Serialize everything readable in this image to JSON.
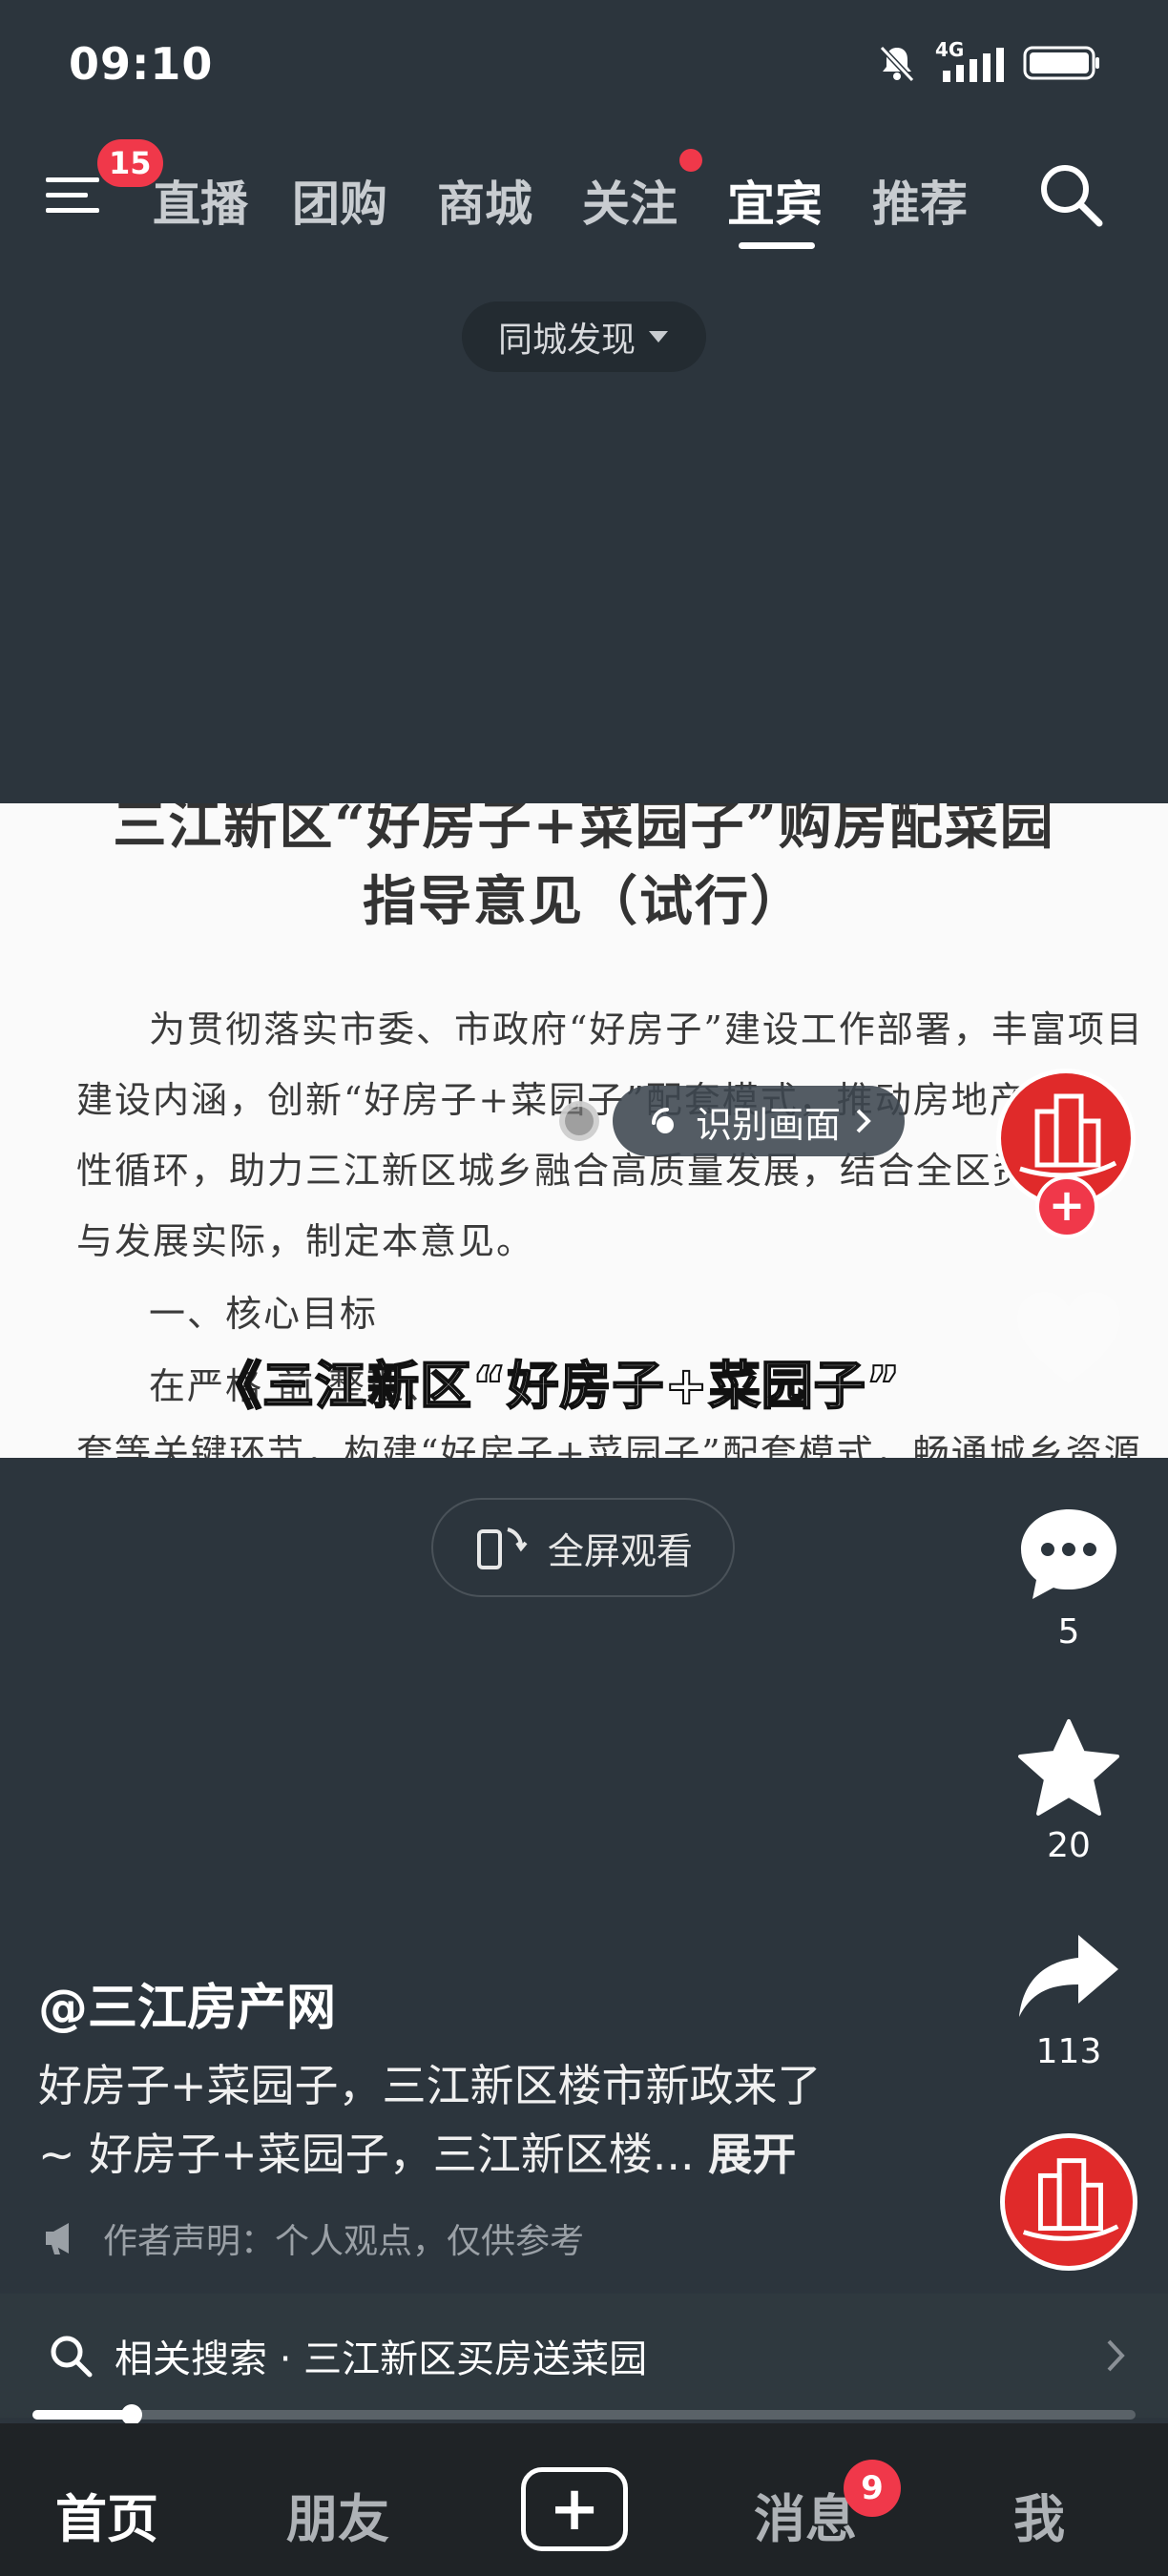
{
  "status": {
    "time": "09:10",
    "network": "4G"
  },
  "topnav": {
    "menu_badge": "15",
    "tabs": [
      "直播",
      "团购",
      "商城",
      "关注",
      "宜宾",
      "推荐"
    ],
    "active_tab": "宜宾"
  },
  "city_filter": {
    "label": "同城发现"
  },
  "document": {
    "title_line1": "三江新区“好房子+菜园子”购房配菜园",
    "title_line2": "指导意见（试行）",
    "lines": [
      "为贯彻落实市委、市政府“好房子”建设工作部署，丰富项目",
      "建设内涵，创新“好房子+菜园子”配套模式，推动房地产市",
      "性循环，助力三江新区城乡融合高质量发展，结合全区资源",
      "与发展实际，制定本意见。",
      "一、核心目标",
      "在严格                前                        整理、",
      "套等关键环节，构建“好房子+菜园子”配套模式，畅通城乡资源"
    ]
  },
  "recognize": {
    "label": "识别画面"
  },
  "subtitle": "《三江新区“好房子+菜园子”",
  "fullscreen": {
    "label": "全屏观看"
  },
  "side_actions": {
    "comments": "5",
    "favorites": "20",
    "shares": "113"
  },
  "post": {
    "author": "@三江房产网",
    "desc_line1": "好房子+菜园子，三江新区楼市新政来了",
    "desc_line2": "~ 好房子+菜园子，三江新区楼...",
    "expand": "展开",
    "notice": "作者声明：个人观点，仅供参考"
  },
  "related_search": {
    "label": "相关搜索 · 三江新区买房送菜园"
  },
  "progress": {
    "value": 0.09
  },
  "bottom_nav": {
    "items": [
      "首页",
      "朋友",
      "消息",
      "我"
    ],
    "active": "首页",
    "message_badge": "9"
  },
  "colors": {
    "accent_red": "#f0384a",
    "background": "#2c353d",
    "bottom_bar": "#1f2326"
  }
}
